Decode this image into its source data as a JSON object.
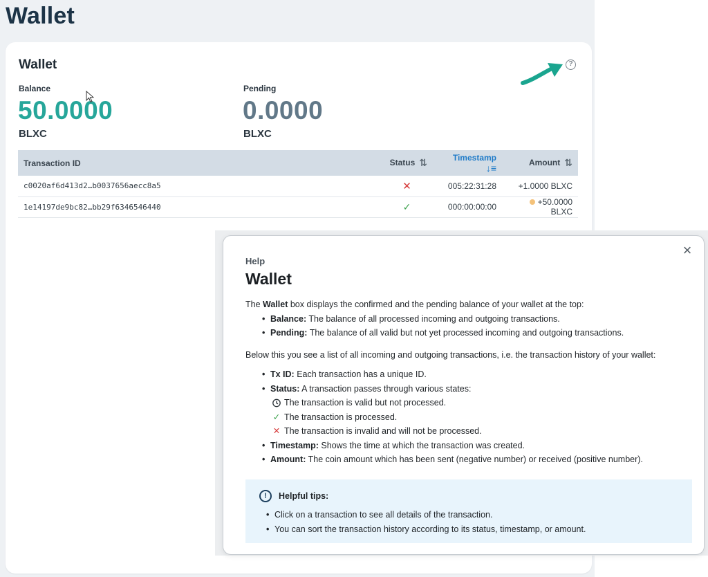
{
  "page": {
    "title": "Wallet"
  },
  "wallet_card": {
    "title": "Wallet",
    "help_icon": "question-circle-icon",
    "balance": {
      "label": "Balance",
      "value": "50.0000",
      "unit": "BLXC",
      "color": "#26a69a"
    },
    "pending": {
      "label": "Pending",
      "value": "0.0000",
      "unit": "BLXC",
      "color": "#617888"
    }
  },
  "table": {
    "columns": {
      "id": "Transaction ID",
      "status": "Status",
      "timestamp": "Timestamp",
      "amount": "Amount"
    },
    "rows": [
      {
        "id": "c0020af6d413d2…b0037656aecc8a5",
        "status": "invalid",
        "status_icon": "✕",
        "timestamp": "005:22:31:28",
        "amount": "+1.0000 BLXC",
        "pending": false
      },
      {
        "id": "1e14197de9bc82…bb29f6346546440",
        "status": "processed",
        "status_icon": "✓",
        "timestamp": "000:00:00:00",
        "amount": "+50.0000 BLXC",
        "pending": true
      }
    ]
  },
  "help": {
    "eyebrow": "Help",
    "title": "Wallet",
    "close": "×",
    "intro_pre": "The ",
    "intro_bold": "Wallet",
    "intro_post": " box displays the confirmed and the pending balance of your wallet at the top:",
    "balance_term": "Balance:",
    "balance_desc": " The balance of all processed incoming and outgoing transactions.",
    "pending_term": "Pending:",
    "pending_desc": " The balance of all valid but not yet processed incoming and outgoing transactions.",
    "list_intro": "Below this you see a list of all incoming and outgoing transactions, i.e. the transaction history of your wallet:",
    "txid_term": "Tx ID:",
    "txid_desc": " Each transaction has a unique ID.",
    "status_term": "Status:",
    "status_desc": " A transaction passes through various states:",
    "state_pending": "The transaction is valid but not processed.",
    "state_processed": "The transaction is processed.",
    "state_invalid": "The transaction is invalid and will not be processed.",
    "timestamp_term": "Timestamp:",
    "timestamp_desc": " Shows the time at which the transaction was created.",
    "amount_term": "Amount:",
    "amount_desc": " The coin amount which has been sent (negative number) or received (positive number).",
    "tips_title": "Helpful tips:",
    "tip1": "Click on a transaction to see all details of the transaction.",
    "tip2": "You can sort the transaction history according to its status, timestamp, or amount."
  }
}
